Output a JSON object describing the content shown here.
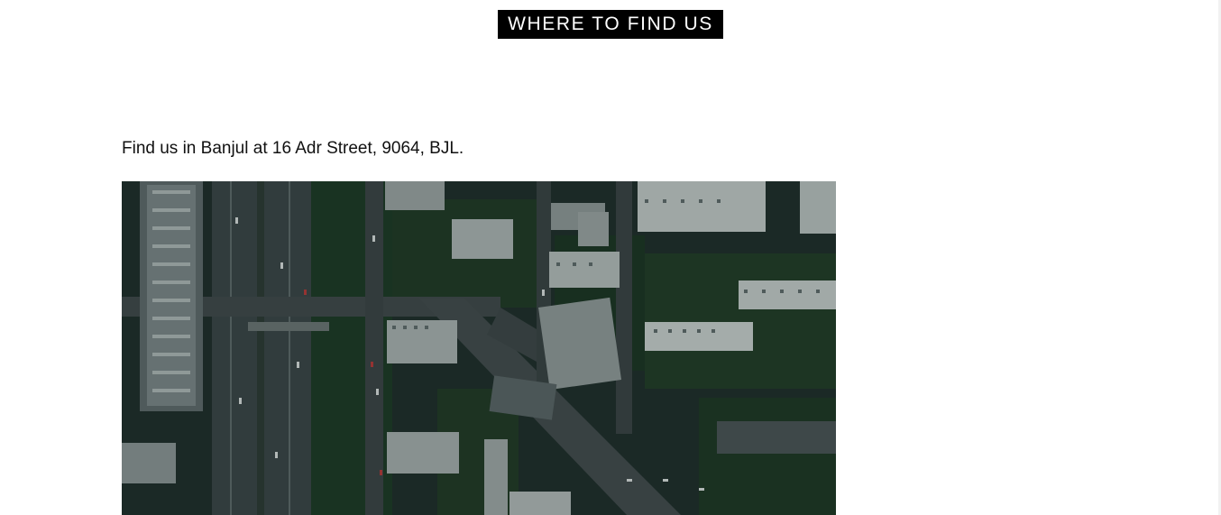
{
  "section": {
    "heading": "WHERE TO FIND US"
  },
  "location": {
    "address_text": "Find us in Banjul at 16 Adr Street, 9064, BJL."
  },
  "image": {
    "subject": "aerial-city-photo"
  },
  "colors": {
    "heading_bg": "#000000",
    "heading_fg": "#ffffff",
    "text": "#111111",
    "background": "#ffffff"
  }
}
